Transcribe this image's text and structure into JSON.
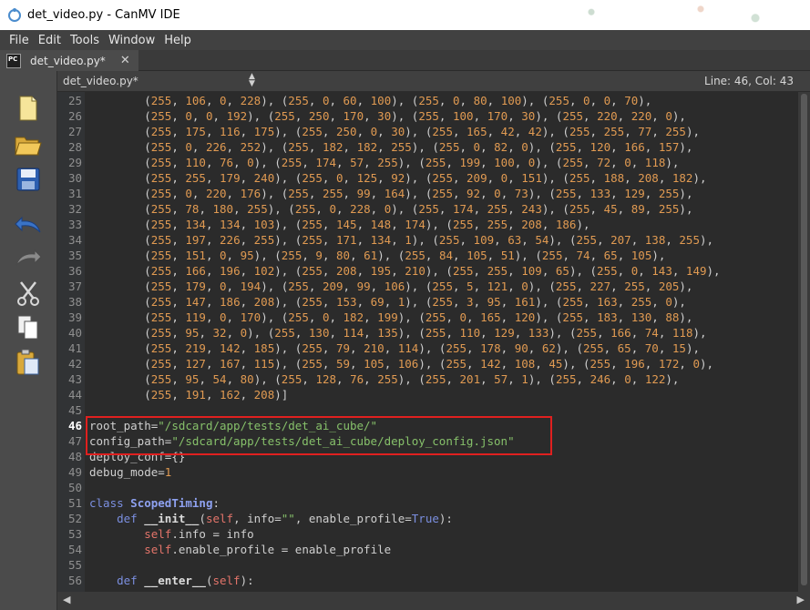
{
  "window": {
    "title": "det_video.py - CanMV IDE"
  },
  "menu": [
    "File",
    "Edit",
    "Tools",
    "Window",
    "Help"
  ],
  "tab": {
    "label": "det_video.py*",
    "close": "✕",
    "icon_text": "PC"
  },
  "editor": {
    "file_combo": "det_video.py*",
    "cursor_position": "Line: 46, Col: 43",
    "current_line": 46
  },
  "sidebar_tools": [
    "new-file-icon",
    "open-folder-icon",
    "save-icon",
    "undo-icon",
    "redo-icon",
    "cut-icon",
    "copy-icon",
    "paste-icon"
  ],
  "code_lines": [
    {
      "n": "25",
      "t": "        (255, 106, 0, 228), (255, 0, 60, 100), (255, 0, 80, 100), (255, 0, 0, 70),"
    },
    {
      "n": "26",
      "t": "        (255, 0, 0, 192), (255, 250, 170, 30), (255, 100, 170, 30), (255, 220, 220, 0),"
    },
    {
      "n": "27",
      "t": "        (255, 175, 116, 175), (255, 250, 0, 30), (255, 165, 42, 42), (255, 255, 77, 255),"
    },
    {
      "n": "28",
      "t": "        (255, 0, 226, 252), (255, 182, 182, 255), (255, 0, 82, 0), (255, 120, 166, 157),"
    },
    {
      "n": "29",
      "t": "        (255, 110, 76, 0), (255, 174, 57, 255), (255, 199, 100, 0), (255, 72, 0, 118),"
    },
    {
      "n": "30",
      "t": "        (255, 255, 179, 240), (255, 0, 125, 92), (255, 209, 0, 151), (255, 188, 208, 182),"
    },
    {
      "n": "31",
      "t": "        (255, 0, 220, 176), (255, 255, 99, 164), (255, 92, 0, 73), (255, 133, 129, 255),"
    },
    {
      "n": "32",
      "t": "        (255, 78, 180, 255), (255, 0, 228, 0), (255, 174, 255, 243), (255, 45, 89, 255),"
    },
    {
      "n": "33",
      "t": "        (255, 134, 134, 103), (255, 145, 148, 174), (255, 255, 208, 186),"
    },
    {
      "n": "34",
      "t": "        (255, 197, 226, 255), (255, 171, 134, 1), (255, 109, 63, 54), (255, 207, 138, 255),"
    },
    {
      "n": "35",
      "t": "        (255, 151, 0, 95), (255, 9, 80, 61), (255, 84, 105, 51), (255, 74, 65, 105),"
    },
    {
      "n": "36",
      "t": "        (255, 166, 196, 102), (255, 208, 195, 210), (255, 255, 109, 65), (255, 0, 143, 149),"
    },
    {
      "n": "37",
      "t": "        (255, 179, 0, 194), (255, 209, 99, 106), (255, 5, 121, 0), (255, 227, 255, 205),"
    },
    {
      "n": "38",
      "t": "        (255, 147, 186, 208), (255, 153, 69, 1), (255, 3, 95, 161), (255, 163, 255, 0),"
    },
    {
      "n": "39",
      "t": "        (255, 119, 0, 170), (255, 0, 182, 199), (255, 0, 165, 120), (255, 183, 130, 88),"
    },
    {
      "n": "40",
      "t": "        (255, 95, 32, 0), (255, 130, 114, 135), (255, 110, 129, 133), (255, 166, 74, 118),"
    },
    {
      "n": "41",
      "t": "        (255, 219, 142, 185), (255, 79, 210, 114), (255, 178, 90, 62), (255, 65, 70, 15),"
    },
    {
      "n": "42",
      "t": "        (255, 127, 167, 115), (255, 59, 105, 106), (255, 142, 108, 45), (255, 196, 172, 0),"
    },
    {
      "n": "43",
      "t": "        (255, 95, 54, 80), (255, 128, 76, 255), (255, 201, 57, 1), (255, 246, 0, 122),"
    },
    {
      "n": "44",
      "t": "        (255, 191, 162, 208)]"
    },
    {
      "n": "45",
      "t": ""
    },
    {
      "n": "46",
      "t": "root_path=\"/sdcard/app/tests/det_ai_cube/\""
    },
    {
      "n": "47",
      "t": "config_path=\"/sdcard/app/tests/det_ai_cube/deploy_config.json\""
    },
    {
      "n": "48",
      "t": "deploy_conf={}"
    },
    {
      "n": "49",
      "t": "debug_mode=1"
    },
    {
      "n": "50",
      "t": ""
    },
    {
      "n": "51",
      "t": "class ScopedTiming:"
    },
    {
      "n": "52",
      "t": "    def __init__(self, info=\"\", enable_profile=True):"
    },
    {
      "n": "53",
      "t": "        self.info = info"
    },
    {
      "n": "54",
      "t": "        self.enable_profile = enable_profile"
    },
    {
      "n": "55",
      "t": ""
    },
    {
      "n": "56",
      "t": "    def __enter__(self):"
    }
  ],
  "colors": {
    "editor_bg": "#2b2b2b",
    "number": "#e09a52",
    "string": "#86c06a",
    "keyword": "#7b8fe0",
    "self": "#e3746a",
    "highlight_box": "#e0201f"
  }
}
